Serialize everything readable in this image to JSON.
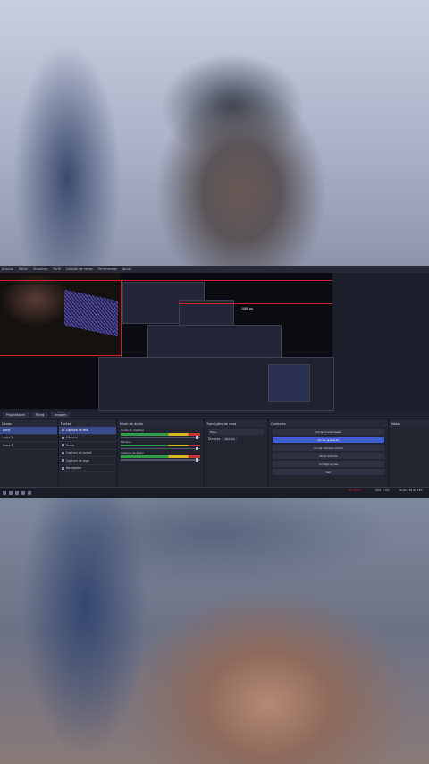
{
  "obs": {
    "menus": [
      "Arquivo",
      "Editar",
      "Visualizar",
      "Perfil",
      "Coleção de cenas",
      "Ferramentas",
      "Ajuda"
    ],
    "preview_label": "1080 px",
    "tabs": [
      "Propriedades",
      "Filtros",
      "Imagem"
    ],
    "scenes": {
      "title": "Cenas",
      "items": [
        "Cena",
        "Cena 2",
        "Cena 3"
      ],
      "selected": 0
    },
    "sources": {
      "title": "Fontes",
      "items": [
        "Captura de tela",
        "Câmera",
        "Áudio",
        "Captura de janela",
        "Captura de jogo",
        "Navegador"
      ]
    },
    "mixer": {
      "title": "Mixer de áudio",
      "tracks": [
        "Áudio do desktop",
        "Mic/Aux",
        "Captura de áudio"
      ]
    },
    "transitions": {
      "title": "Transições de cena",
      "selected": "Fade",
      "duration_label": "Duração",
      "duration": "300 ms"
    },
    "controls": {
      "title": "Controles",
      "start_streaming": "Iniciar transmissão",
      "start_recording": "Iniciar gravação",
      "start_virtualcam": "Iniciar câmera virtual",
      "studio_mode": "Modo estúdio",
      "settings": "Configurações",
      "exit": "Sair"
    },
    "notes": {
      "title": "Notas",
      "body": ""
    },
    "status": {
      "rec_time": "00:00:00",
      "cpu": "CPU: 1.3%",
      "fps": "30.00 / 30.00 FPS"
    },
    "colors": {
      "accent": "#3f5fd0",
      "live": "#d0202a",
      "bg": "#1c1f2b"
    }
  }
}
